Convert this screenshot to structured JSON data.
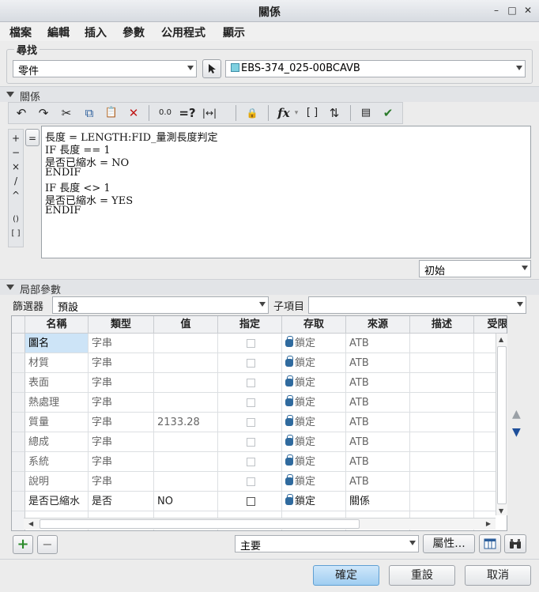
{
  "window": {
    "title": "關係",
    "minimize": "–",
    "maximize": "□",
    "close": "✕"
  },
  "menu": [
    "檔案",
    "編輯",
    "插入",
    "參數",
    "公用程式",
    "顯示"
  ],
  "search": {
    "group_label": "尋找",
    "type_value": "零件",
    "model_value": "EBS-374_025-00BCAVB"
  },
  "relations": {
    "section_label": "關係",
    "toolbar": {
      "undo": "↶",
      "redo": "↷",
      "cut": "✂",
      "copy": "⧉",
      "paste": "📋",
      "delete": "✕",
      "units": "0.0",
      "eval": "=?",
      "measure": "|↔|",
      "lock": "🔒",
      "fx": "fx",
      "brackets": "[ ]",
      "sort": "⇅",
      "check": "✔"
    },
    "operators": [
      "+",
      "−",
      "×",
      "/",
      "^",
      "()",
      "[ ]"
    ],
    "equals": "=",
    "code": [
      "長度 = LENGTH:FID_量測長度判定",
      "IF 長度 == 1",
      "是否已縮水 = NO",
      "ENDIF",
      "IF 長度 <> 1",
      "是否已縮水 = YES",
      "ENDIF"
    ],
    "init_value": "初始"
  },
  "local_params": {
    "section_label": "局部參數",
    "filter_label": "篩選器",
    "filter_value": "預設",
    "child_label": "子項目",
    "child_value": "",
    "columns": [
      "名稱",
      "類型",
      "值",
      "指定",
      "存取",
      "來源",
      "描述",
      "受限"
    ],
    "rows": [
      {
        "name": "圖名",
        "type": "字串",
        "value": "",
        "assigned": false,
        "access": "鎖定",
        "source": "ATB",
        "desc": "",
        "dark": false,
        "selected": true
      },
      {
        "name": "材質",
        "type": "字串",
        "value": "",
        "assigned": false,
        "access": "鎖定",
        "source": "ATB",
        "desc": "",
        "dark": false,
        "selected": false
      },
      {
        "name": "表面",
        "type": "字串",
        "value": "",
        "assigned": false,
        "access": "鎖定",
        "source": "ATB",
        "desc": "",
        "dark": false,
        "selected": false
      },
      {
        "name": "熱處理",
        "type": "字串",
        "value": "",
        "assigned": false,
        "access": "鎖定",
        "source": "ATB",
        "desc": "",
        "dark": false,
        "selected": false
      },
      {
        "name": "質量",
        "type": "字串",
        "value": "2133.28",
        "assigned": false,
        "access": "鎖定",
        "source": "ATB",
        "desc": "",
        "dark": false,
        "selected": false
      },
      {
        "name": "總成",
        "type": "字串",
        "value": "",
        "assigned": false,
        "access": "鎖定",
        "source": "ATB",
        "desc": "",
        "dark": false,
        "selected": false
      },
      {
        "name": "系統",
        "type": "字串",
        "value": "",
        "assigned": false,
        "access": "鎖定",
        "source": "ATB",
        "desc": "",
        "dark": false,
        "selected": false
      },
      {
        "name": "說明",
        "type": "字串",
        "value": "",
        "assigned": false,
        "access": "鎖定",
        "source": "ATB",
        "desc": "",
        "dark": false,
        "selected": false
      },
      {
        "name": "是否已縮水",
        "type": "是否",
        "value": "NO",
        "assigned": false,
        "access": "鎖定",
        "source": "關係",
        "desc": "",
        "dark": true,
        "selected": false
      }
    ],
    "add": "+",
    "remove": "−",
    "main_value": "主要",
    "properties": "屬性..."
  },
  "footer": {
    "ok": "確定",
    "reset": "重設",
    "cancel": "取消"
  },
  "colors": {
    "accent": "#2f6a9e",
    "primary_button": "#9fcdf1",
    "selection": "#cde4f7"
  }
}
